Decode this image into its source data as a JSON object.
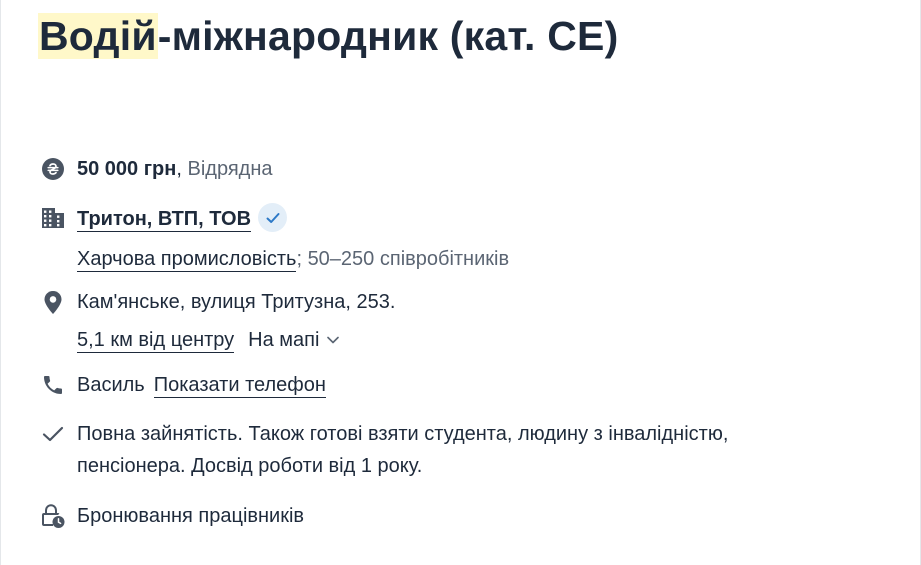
{
  "job": {
    "title_highlight": "Водій",
    "title_rest": "-міжнародник (кат. CE)"
  },
  "salary": {
    "amount": "50 000 грн",
    "separator": ",",
    "note": "Відрядна",
    "icon": "hryvnia-currency-icon"
  },
  "company": {
    "name": "Тритон, ВТП, ТОВ",
    "verified_icon": "check-icon",
    "industry": "Харчова промисловість",
    "separator": ";",
    "size": "50–250 співробітників",
    "icon": "building-icon"
  },
  "location": {
    "address": "Кам'янське, вулиця Тритузна, 253.",
    "distance": "5,1 км від центру",
    "map_label": "На мапі",
    "icon": "map-pin-icon"
  },
  "contact": {
    "name": "Василь",
    "show_phone": "Показати телефон",
    "icon": "phone-icon"
  },
  "conditions": {
    "line1": "Повна зайнятість. Також готові взяти студента, людину з інвалідністю,",
    "line2": "пенсіонера. Досвід роботи від 1 року.",
    "icon": "checkmark-icon"
  },
  "reservation": {
    "label": "Бронювання працівників",
    "icon": "lock-clock-icon"
  },
  "colors": {
    "text": "#1e2a3b",
    "muted": "#5b6573",
    "highlight": "#fff8c9",
    "verified_bg": "#e3eef8",
    "verified_check": "#2d79c7"
  }
}
